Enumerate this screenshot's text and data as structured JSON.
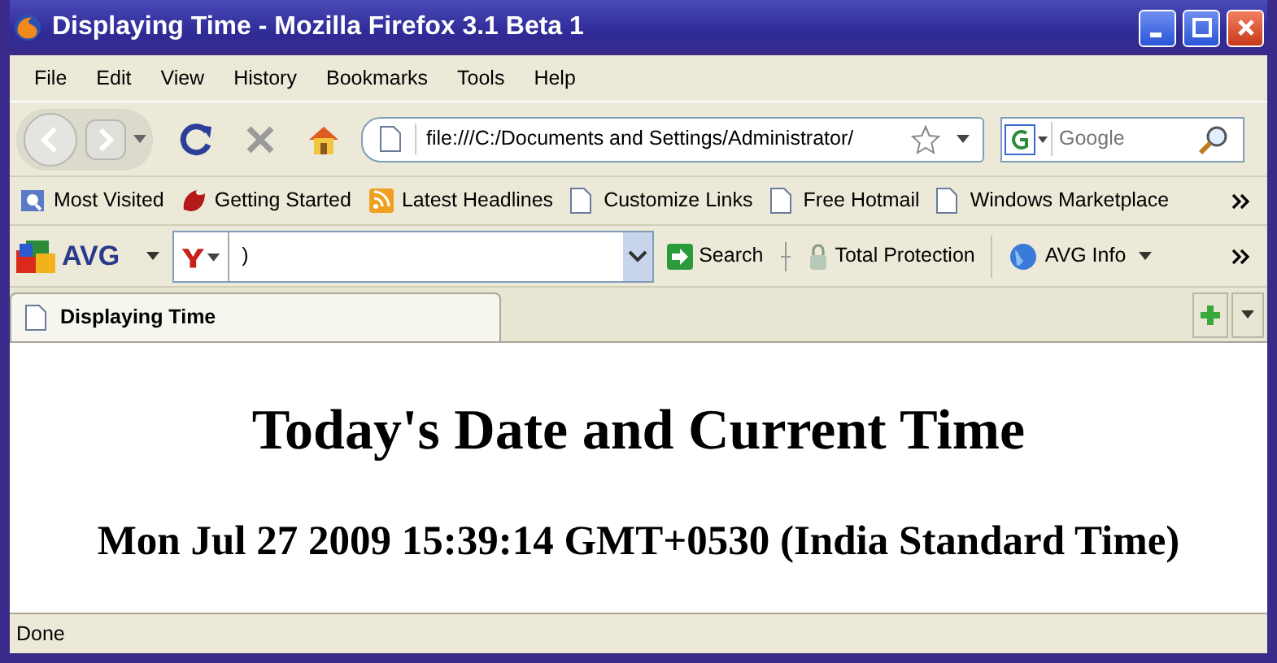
{
  "window": {
    "title": "Displaying Time - Mozilla Firefox 3.1 Beta 1"
  },
  "menu": [
    "File",
    "Edit",
    "View",
    "History",
    "Bookmarks",
    "Tools",
    "Help"
  ],
  "navigation": {
    "url": "file:///C:/Documents and Settings/Administrator/",
    "search_placeholder": "Google"
  },
  "bookmarks": [
    {
      "label": "Most Visited"
    },
    {
      "label": "Getting Started"
    },
    {
      "label": "Latest Headlines"
    },
    {
      "label": "Customize Links"
    },
    {
      "label": "Free Hotmail"
    },
    {
      "label": "Windows Marketplace"
    }
  ],
  "avg_toolbar": {
    "logo": "AVG",
    "search_value": ")",
    "buttons": [
      "Search",
      "Total Protection",
      "AVG Info"
    ]
  },
  "tabs": [
    {
      "label": "Displaying Time",
      "selected": true
    }
  ],
  "page": {
    "heading": "Today's Date and Current Time",
    "time": "Mon Jul 27 2009 15:39:14 GMT+0530 (India Standard Time)"
  },
  "status_bar": {
    "text": "Done"
  }
}
